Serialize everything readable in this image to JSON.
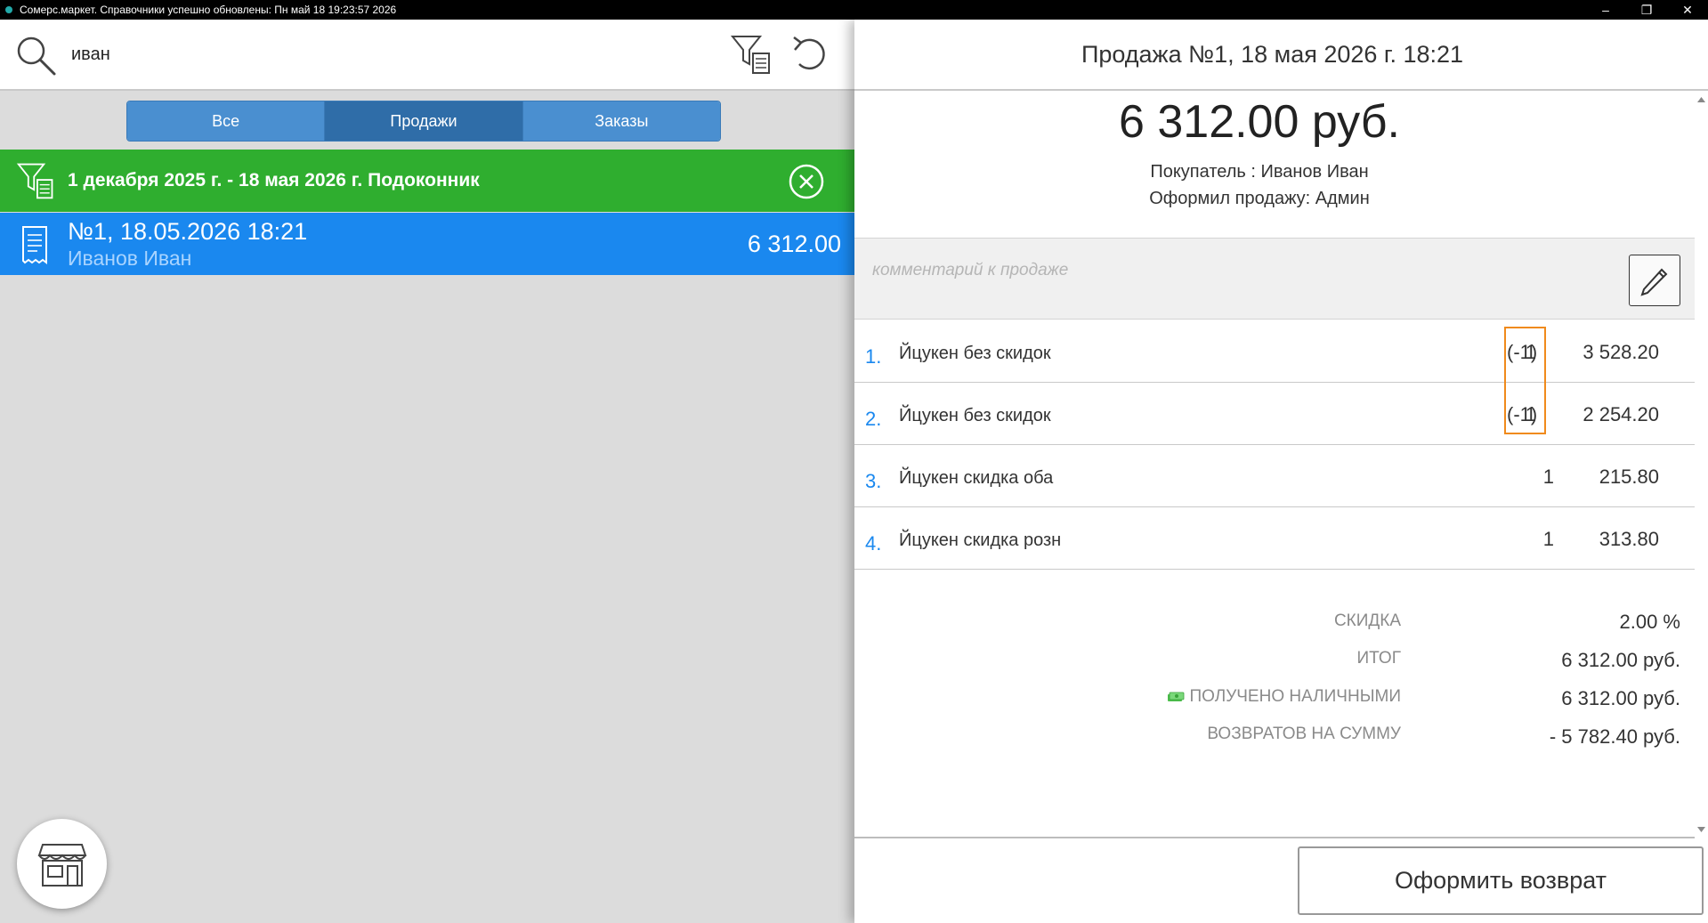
{
  "window": {
    "title": "Сомерс.маркет. Справочники успешно обновлены: Пн май 18 19:23:57 2026",
    "controls": [
      "–",
      "❐",
      "✕"
    ]
  },
  "search": {
    "value": "иван"
  },
  "tabs": [
    {
      "label": "Все",
      "active": false
    },
    {
      "label": "Продажи",
      "active": true
    },
    {
      "label": "Заказы",
      "active": false
    }
  ],
  "filter": {
    "text": "1 декабря 2025 г. - 18 мая 2026 г. Подоконник"
  },
  "sale_list": [
    {
      "title": "№1, 18.05.2026 18:21",
      "customer": "Иванов Иван",
      "amount": "6 312.00"
    }
  ],
  "detail": {
    "header": "Продажа №1, 18 мая 2026 г. 18:21",
    "total": "6 312.00 руб.",
    "buyer": "Покупатель : Иванов Иван",
    "seller": "Оформил продажу: Админ",
    "comment_placeholder": "комментарий к продаже",
    "items": [
      {
        "num": "1.",
        "name": "Йцукен без скидок",
        "qty": "1",
        "returned": "(-1)",
        "sum": "3 528.20"
      },
      {
        "num": "2.",
        "name": "Йцукен без скидок",
        "qty": "1",
        "returned": "(-1)",
        "sum": "2 254.20"
      },
      {
        "num": "3.",
        "name": "Йцукен скидка оба",
        "qty": "1",
        "returned": "",
        "sum": "215.80"
      },
      {
        "num": "4.",
        "name": "Йцукен скидка розн",
        "qty": "1",
        "returned": "",
        "sum": "313.80"
      }
    ],
    "summary": [
      {
        "label": "СКИДКА",
        "value": "2.00 %"
      },
      {
        "label": "ИТОГ",
        "value": "6 312.00 руб."
      },
      {
        "label": "ПОЛУЧЕНО НАЛИЧНЫМИ",
        "value": "6 312.00 руб.",
        "icon": "cash-icon"
      },
      {
        "label": "ВОЗВРАТОВ НА СУММУ",
        "value": "- 5 782.40 руб."
      }
    ],
    "return_button": "Оформить возврат"
  },
  "colors": {
    "filter_green": "#2fae2f",
    "selected_blue": "#1a88ef",
    "tab_blue": "#4a8fd0",
    "tab_active": "#2f6da8",
    "highlight_orange": "#f08a1c"
  }
}
